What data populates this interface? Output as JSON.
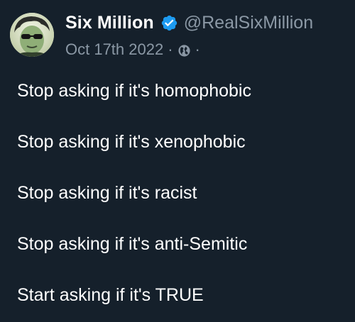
{
  "author": {
    "display_name": "Six Million",
    "handle": "@RealSixMillion",
    "verified": true,
    "avatar_icon": "avatar-photo"
  },
  "meta": {
    "date": "Oct 17th 2022",
    "separator": "·",
    "visibility_icon": "globe-icon"
  },
  "tweet": {
    "lines": [
      "Stop asking if it's homophobic",
      "Stop asking if it's xenophobic",
      "Stop asking if it's racist",
      "Stop asking if it's anti-Semitic",
      "Start asking if it's TRUE"
    ]
  },
  "colors": {
    "background": "#15202b",
    "primary_text": "#ffffff",
    "secondary_text": "#8b98a5",
    "verified_badge": "#1d9bf0"
  }
}
